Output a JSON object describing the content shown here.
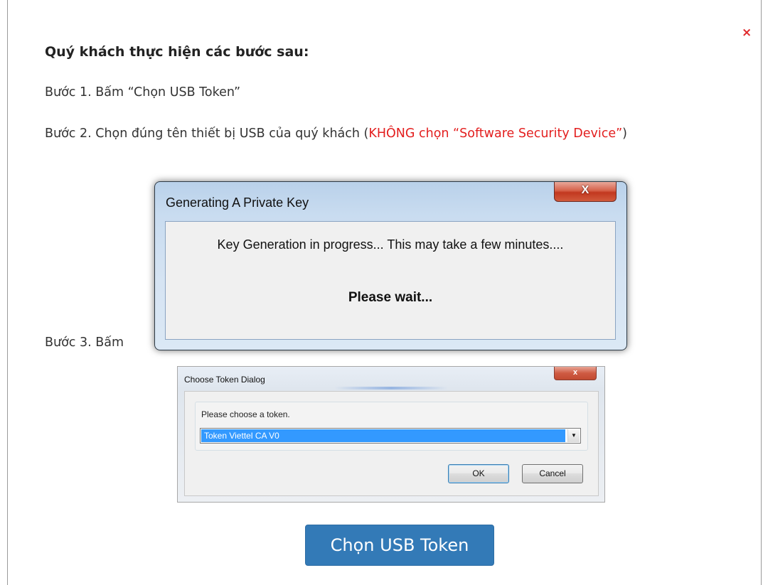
{
  "modal": {
    "close_label": "×",
    "heading": "Quý khách thực hiện các bước sau:",
    "step1": "Bước 1. Bấm “Chọn USB Token”",
    "step2_prefix": "Bước 2. Chọn đúng tên thiết bị USB của quý khách (",
    "step2_warning": "KHÔNG chọn “Software Security Device”",
    "step2_suffix": ")",
    "step3": "Bước 3. Bấm",
    "primary_button": "Chọn USB Token"
  },
  "key_dialog": {
    "title": "Generating A Private Key",
    "close_label": "X",
    "message": "Key Generation in progress... This may take a few minutes....",
    "wait": "Please wait..."
  },
  "token_dialog": {
    "title": "Choose Token Dialog",
    "close_label": "x",
    "prompt": "Please choose a token.",
    "selected_token": "Token Viettel CA V0",
    "ok_label": "OK",
    "cancel_label": "Cancel"
  },
  "colors": {
    "warning": "#e31e1e",
    "primary": "#337ab7",
    "selection": "#3399ff"
  }
}
